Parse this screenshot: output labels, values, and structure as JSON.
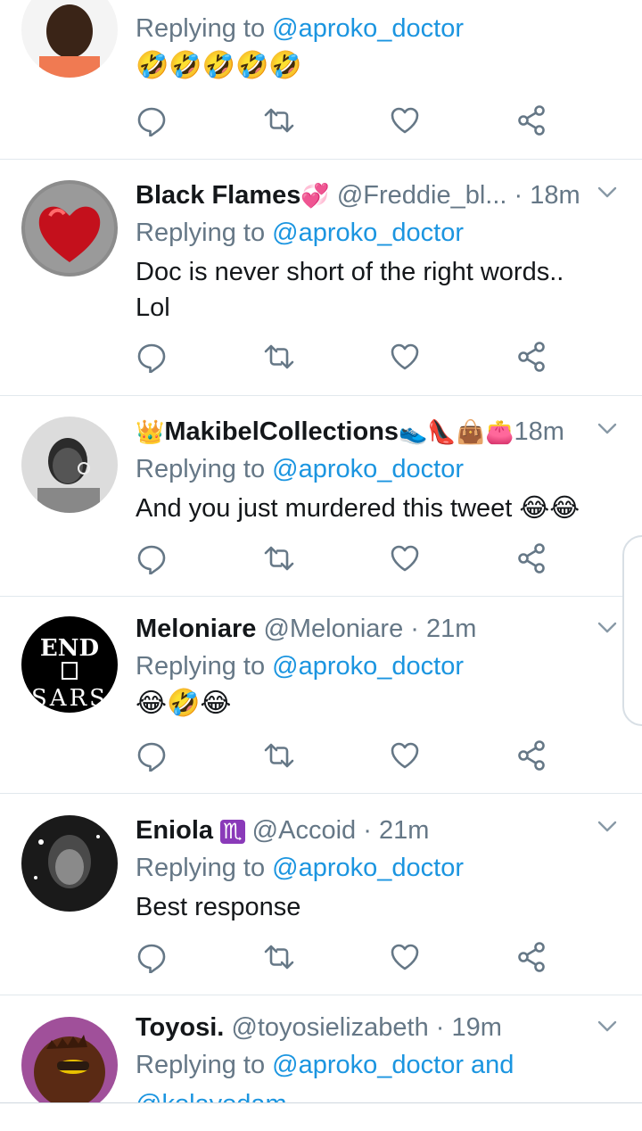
{
  "colors": {
    "link": "#1b95e0",
    "secondary_text": "#657786",
    "primary_text": "#14171a",
    "divider": "#e1e8ed"
  },
  "action_icons": [
    "reply-icon",
    "retweet-icon",
    "like-icon",
    "share-icon"
  ],
  "tweets": [
    {
      "display_name": "",
      "handle": "",
      "time": "",
      "replying_label": "Replying to ",
      "mention": "@aproko_doctor",
      "text": "",
      "emoji": "🤣🤣🤣🤣🤣"
    },
    {
      "display_name": "Black Flames",
      "name_badge": "💞",
      "handle": "@Freddie_bl...",
      "dot": "·",
      "time": "18m",
      "replying_label": "Replying to ",
      "mention": "@aproko_doctor",
      "text": "Doc is never short of the right words.. Lol"
    },
    {
      "name_prefix": "👑",
      "display_name": "MakibelCollections",
      "name_badge": "👟👠👜👛",
      "handle": "",
      "time": "18m",
      "replying_label": "Replying to ",
      "mention": "@aproko_doctor",
      "text": "And you just murdered this tweet 😂😂"
    },
    {
      "display_name": "Meloniare",
      "handle": "@Meloniare",
      "dot": "·",
      "time": "21m",
      "replying_label": "Replying to ",
      "mention": "@aproko_doctor",
      "emoji": "😂🤣😂",
      "avatar_text_top": "END",
      "avatar_text_bottom": "SARS"
    },
    {
      "display_name": "Eniola",
      "name_badge": "♏",
      "handle": "@Accoid",
      "dot": "·",
      "time": "21m",
      "replying_label": "Replying to ",
      "mention": "@aproko_doctor",
      "text": "Best response"
    },
    {
      "display_name": "Toyosi.",
      "handle": "@toyosielizabeth",
      "dot": "·",
      "time": "19m",
      "replying_label": "Replying to ",
      "mention": "@aproko_doctor and",
      "mention2": "@kolayodam"
    }
  ]
}
